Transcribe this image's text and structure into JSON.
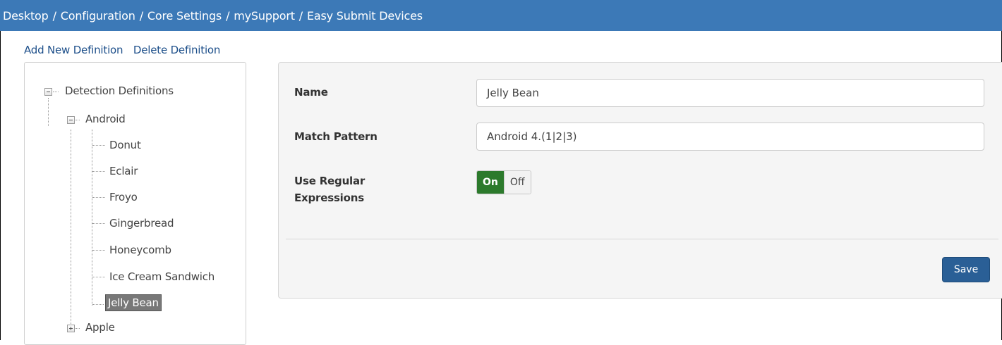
{
  "breadcrumb": {
    "items": [
      "Desktop",
      "Configuration",
      "Core Settings",
      "mySupport",
      "Easy Submit Devices"
    ],
    "separator": "/"
  },
  "actions": {
    "add": "Add New Definition",
    "delete": "Delete Definition"
  },
  "tree": {
    "root": "Detection Definitions",
    "android": "Android",
    "children": [
      "Donut",
      "Eclair",
      "Froyo",
      "Gingerbread",
      "Honeycomb",
      "Ice Cream Sandwich",
      "Jelly Bean"
    ],
    "apple": "Apple",
    "selected": "Jelly Bean"
  },
  "form": {
    "name_label": "Name",
    "name_value": "Jelly Bean",
    "pattern_label": "Match Pattern",
    "pattern_value": "Android 4.(1|2|3)",
    "regex_label_line1": "Use Regular",
    "regex_label_line2": "Expressions",
    "toggle_on": "On",
    "toggle_off": "Off",
    "save": "Save"
  },
  "colors": {
    "topbar": "#3c79b7",
    "toggle_on": "#2c7a2c",
    "save_button": "#2a5f96",
    "selected_node": "#787878"
  }
}
